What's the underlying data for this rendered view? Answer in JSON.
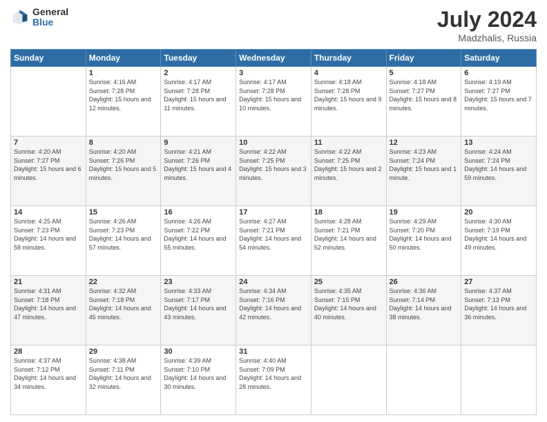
{
  "logo": {
    "general": "General",
    "blue": "Blue"
  },
  "title": {
    "month_year": "July 2024",
    "location": "Madzhalis, Russia"
  },
  "days_of_week": [
    "Sunday",
    "Monday",
    "Tuesday",
    "Wednesday",
    "Thursday",
    "Friday",
    "Saturday"
  ],
  "weeks": [
    [
      {
        "day": "",
        "sunrise": "",
        "sunset": "",
        "daylight": ""
      },
      {
        "day": "1",
        "sunrise": "Sunrise: 4:16 AM",
        "sunset": "Sunset: 7:28 PM",
        "daylight": "Daylight: 15 hours and 12 minutes."
      },
      {
        "day": "2",
        "sunrise": "Sunrise: 4:17 AM",
        "sunset": "Sunset: 7:28 PM",
        "daylight": "Daylight: 15 hours and 11 minutes."
      },
      {
        "day": "3",
        "sunrise": "Sunrise: 4:17 AM",
        "sunset": "Sunset: 7:28 PM",
        "daylight": "Daylight: 15 hours and 10 minutes."
      },
      {
        "day": "4",
        "sunrise": "Sunrise: 4:18 AM",
        "sunset": "Sunset: 7:28 PM",
        "daylight": "Daylight: 15 hours and 9 minutes."
      },
      {
        "day": "5",
        "sunrise": "Sunrise: 4:18 AM",
        "sunset": "Sunset: 7:27 PM",
        "daylight": "Daylight: 15 hours and 8 minutes."
      },
      {
        "day": "6",
        "sunrise": "Sunrise: 4:19 AM",
        "sunset": "Sunset: 7:27 PM",
        "daylight": "Daylight: 15 hours and 7 minutes."
      }
    ],
    [
      {
        "day": "7",
        "sunrise": "Sunrise: 4:20 AM",
        "sunset": "Sunset: 7:27 PM",
        "daylight": "Daylight: 15 hours and 6 minutes."
      },
      {
        "day": "8",
        "sunrise": "Sunrise: 4:20 AM",
        "sunset": "Sunset: 7:26 PM",
        "daylight": "Daylight: 15 hours and 5 minutes."
      },
      {
        "day": "9",
        "sunrise": "Sunrise: 4:21 AM",
        "sunset": "Sunset: 7:26 PM",
        "daylight": "Daylight: 15 hours and 4 minutes."
      },
      {
        "day": "10",
        "sunrise": "Sunrise: 4:22 AM",
        "sunset": "Sunset: 7:25 PM",
        "daylight": "Daylight: 15 hours and 3 minutes."
      },
      {
        "day": "11",
        "sunrise": "Sunrise: 4:22 AM",
        "sunset": "Sunset: 7:25 PM",
        "daylight": "Daylight: 15 hours and 2 minutes."
      },
      {
        "day": "12",
        "sunrise": "Sunrise: 4:23 AM",
        "sunset": "Sunset: 7:24 PM",
        "daylight": "Daylight: 15 hours and 1 minute."
      },
      {
        "day": "13",
        "sunrise": "Sunrise: 4:24 AM",
        "sunset": "Sunset: 7:24 PM",
        "daylight": "Daylight: 14 hours and 59 minutes."
      }
    ],
    [
      {
        "day": "14",
        "sunrise": "Sunrise: 4:25 AM",
        "sunset": "Sunset: 7:23 PM",
        "daylight": "Daylight: 14 hours and 58 minutes."
      },
      {
        "day": "15",
        "sunrise": "Sunrise: 4:26 AM",
        "sunset": "Sunset: 7:23 PM",
        "daylight": "Daylight: 14 hours and 57 minutes."
      },
      {
        "day": "16",
        "sunrise": "Sunrise: 4:26 AM",
        "sunset": "Sunset: 7:22 PM",
        "daylight": "Daylight: 14 hours and 55 minutes."
      },
      {
        "day": "17",
        "sunrise": "Sunrise: 4:27 AM",
        "sunset": "Sunset: 7:21 PM",
        "daylight": "Daylight: 14 hours and 54 minutes."
      },
      {
        "day": "18",
        "sunrise": "Sunrise: 4:28 AM",
        "sunset": "Sunset: 7:21 PM",
        "daylight": "Daylight: 14 hours and 52 minutes."
      },
      {
        "day": "19",
        "sunrise": "Sunrise: 4:29 AM",
        "sunset": "Sunset: 7:20 PM",
        "daylight": "Daylight: 14 hours and 50 minutes."
      },
      {
        "day": "20",
        "sunrise": "Sunrise: 4:30 AM",
        "sunset": "Sunset: 7:19 PM",
        "daylight": "Daylight: 14 hours and 49 minutes."
      }
    ],
    [
      {
        "day": "21",
        "sunrise": "Sunrise: 4:31 AM",
        "sunset": "Sunset: 7:18 PM",
        "daylight": "Daylight: 14 hours and 47 minutes."
      },
      {
        "day": "22",
        "sunrise": "Sunrise: 4:32 AM",
        "sunset": "Sunset: 7:18 PM",
        "daylight": "Daylight: 14 hours and 45 minutes."
      },
      {
        "day": "23",
        "sunrise": "Sunrise: 4:33 AM",
        "sunset": "Sunset: 7:17 PM",
        "daylight": "Daylight: 14 hours and 43 minutes."
      },
      {
        "day": "24",
        "sunrise": "Sunrise: 4:34 AM",
        "sunset": "Sunset: 7:16 PM",
        "daylight": "Daylight: 14 hours and 42 minutes."
      },
      {
        "day": "25",
        "sunrise": "Sunrise: 4:35 AM",
        "sunset": "Sunset: 7:15 PM",
        "daylight": "Daylight: 14 hours and 40 minutes."
      },
      {
        "day": "26",
        "sunrise": "Sunrise: 4:36 AM",
        "sunset": "Sunset: 7:14 PM",
        "daylight": "Daylight: 14 hours and 38 minutes."
      },
      {
        "day": "27",
        "sunrise": "Sunrise: 4:37 AM",
        "sunset": "Sunset: 7:13 PM",
        "daylight": "Daylight: 14 hours and 36 minutes."
      }
    ],
    [
      {
        "day": "28",
        "sunrise": "Sunrise: 4:37 AM",
        "sunset": "Sunset: 7:12 PM",
        "daylight": "Daylight: 14 hours and 34 minutes."
      },
      {
        "day": "29",
        "sunrise": "Sunrise: 4:38 AM",
        "sunset": "Sunset: 7:11 PM",
        "daylight": "Daylight: 14 hours and 32 minutes."
      },
      {
        "day": "30",
        "sunrise": "Sunrise: 4:39 AM",
        "sunset": "Sunset: 7:10 PM",
        "daylight": "Daylight: 14 hours and 30 minutes."
      },
      {
        "day": "31",
        "sunrise": "Sunrise: 4:40 AM",
        "sunset": "Sunset: 7:09 PM",
        "daylight": "Daylight: 14 hours and 28 minutes."
      },
      {
        "day": "",
        "sunrise": "",
        "sunset": "",
        "daylight": ""
      },
      {
        "day": "",
        "sunrise": "",
        "sunset": "",
        "daylight": ""
      },
      {
        "day": "",
        "sunrise": "",
        "sunset": "",
        "daylight": ""
      }
    ]
  ]
}
